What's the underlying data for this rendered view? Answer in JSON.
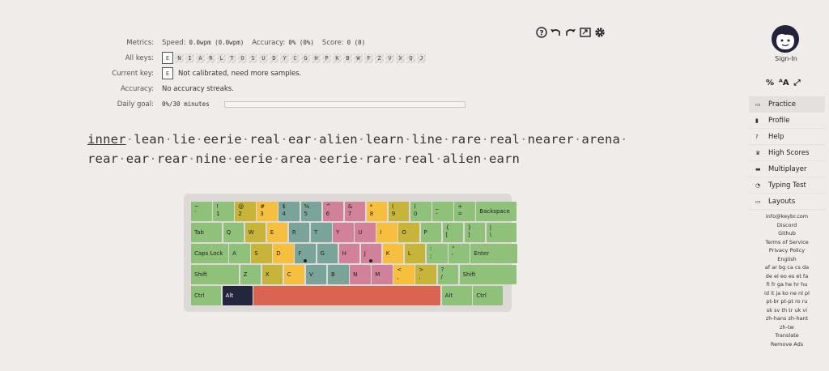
{
  "metrics": {
    "label": "Metrics:",
    "speed_name": "Speed:",
    "speed_val": "0.0wpm (0.0wpm)",
    "accuracy_name": "Accuracy:",
    "accuracy_val": "0% (0%)",
    "score_name": "Score:",
    "score_val": "0 (0)"
  },
  "all_keys": {
    "label": "All keys:",
    "keys": [
      "E",
      "N",
      "I",
      "A",
      "R",
      "L",
      "T",
      "O",
      "S",
      "U",
      "D",
      "Y",
      "C",
      "G",
      "H",
      "P",
      "K",
      "B",
      "W",
      "F",
      "Z",
      "V",
      "X",
      "Q",
      "J"
    ]
  },
  "current_key": {
    "label": "Current key:",
    "key": "E",
    "status": "Not calibrated, need more samples."
  },
  "accuracy_row": {
    "label": "Accuracy:",
    "text": "No accuracy streaks."
  },
  "daily_goal": {
    "label": "Daily goal:",
    "text": "0%/30 minutes",
    "progress": 0
  },
  "lesson": {
    "line1": [
      "inner",
      "lean",
      "lie",
      "eerie",
      "real",
      "ear",
      "alien",
      "learn",
      "line",
      "rare",
      "real",
      "nearer",
      "arena"
    ],
    "line2": [
      "rear",
      "ear",
      "rear",
      "nine",
      "eerie",
      "area",
      "eerie",
      "rare",
      "real",
      "alien",
      "earn"
    ]
  },
  "keyboard_rows": [
    [
      [
        "~",
        "`",
        "g"
      ],
      [
        "!",
        "1",
        "g"
      ],
      [
        "@",
        "2",
        "y"
      ],
      [
        "#",
        "3",
        "o"
      ],
      [
        "$",
        "4",
        "t"
      ],
      [
        "%",
        "5",
        "t"
      ],
      [
        "^",
        "6",
        "p"
      ],
      [
        "&",
        "7",
        "p"
      ],
      [
        "*",
        "8",
        "o"
      ],
      [
        "(",
        "9",
        "y"
      ],
      [
        ")",
        "0",
        "g"
      ],
      [
        "_",
        "-",
        "g"
      ],
      [
        "+",
        "=",
        "g"
      ],
      [
        "",
        "Backspace",
        "g"
      ]
    ],
    [
      [
        "",
        "Tab",
        "g"
      ],
      [
        "",
        "Q",
        "g"
      ],
      [
        "",
        "W",
        "y"
      ],
      [
        "",
        "E",
        "o"
      ],
      [
        "",
        "R",
        "t"
      ],
      [
        "",
        "T",
        "t"
      ],
      [
        "",
        "Y",
        "p"
      ],
      [
        "",
        "U",
        "p"
      ],
      [
        "",
        "I",
        "o"
      ],
      [
        "",
        "O",
        "y"
      ],
      [
        "",
        "P",
        "g"
      ],
      [
        "{",
        "[",
        "g"
      ],
      [
        "}",
        "]",
        "g"
      ],
      [
        "|",
        "\\",
        "g"
      ]
    ],
    [
      [
        "",
        "Caps Lock",
        "g"
      ],
      [
        "",
        "A",
        "g"
      ],
      [
        "",
        "S",
        "y"
      ],
      [
        "",
        "D",
        "o"
      ],
      [
        "",
        "F",
        "t"
      ],
      [
        "",
        "G",
        "t"
      ],
      [
        "",
        "H",
        "p"
      ],
      [
        "",
        "J",
        "p"
      ],
      [
        "",
        "K",
        "o"
      ],
      [
        "",
        "L",
        "y"
      ],
      [
        ":",
        ";",
        "g"
      ],
      [
        "\"",
        "'",
        "g"
      ],
      [
        "",
        "Enter",
        "g"
      ]
    ],
    [
      [
        "",
        "Shift",
        "g"
      ],
      [
        "",
        "Z",
        "g"
      ],
      [
        "",
        "X",
        "y"
      ],
      [
        "",
        "C",
        "o"
      ],
      [
        "",
        "V",
        "t"
      ],
      [
        "",
        "B",
        "t"
      ],
      [
        "",
        "N",
        "p"
      ],
      [
        "",
        "M",
        "p"
      ],
      [
        "<",
        ",",
        "o"
      ],
      [
        ">",
        ".",
        "y"
      ],
      [
        "?",
        "/",
        "g"
      ],
      [
        "",
        "Shift",
        "g"
      ]
    ],
    [
      [
        "",
        "Ctrl",
        "g"
      ],
      [
        "",
        "Alt",
        "dark"
      ],
      [
        "",
        "",
        "red"
      ],
      [
        "",
        "Alt",
        "g"
      ],
      [
        "",
        "Ctrl",
        "g"
      ]
    ]
  ],
  "sidebar": {
    "signin": "Sign-In",
    "nav": [
      {
        "label": "Practice",
        "icon": "keyboard-icon"
      },
      {
        "label": "Profile",
        "icon": "chart-icon"
      },
      {
        "label": "Help",
        "icon": "help-icon"
      },
      {
        "label": "High Scores",
        "icon": "trophy-icon"
      },
      {
        "label": "Multiplayer",
        "icon": "car-icon"
      },
      {
        "label": "Typing Test",
        "icon": "gauge-icon"
      },
      {
        "label": "Layouts",
        "icon": "keyboard-icon"
      }
    ],
    "links": [
      "info@keybr.com",
      "Discord",
      "Github",
      "Terms of Service",
      "Privacy Policy",
      "English",
      "af ar bg ca cs da",
      "de el eo es et fa",
      "fi fr ga he hr hu",
      "id it ja ko ne nl pl",
      "pt-br pt-pt ro ru",
      "sk sv th tr uk vi",
      "zh-hans zh-hant",
      "zh-tw",
      "Translate",
      "Remove Ads"
    ]
  },
  "colors": {
    "green": "#8fc17a",
    "orange": "#f6bf3f",
    "olive": "#c6b53a",
    "teal": "#7aa49a",
    "pink": "#d1819a",
    "space": "#d96452",
    "alt": "#24263d"
  }
}
